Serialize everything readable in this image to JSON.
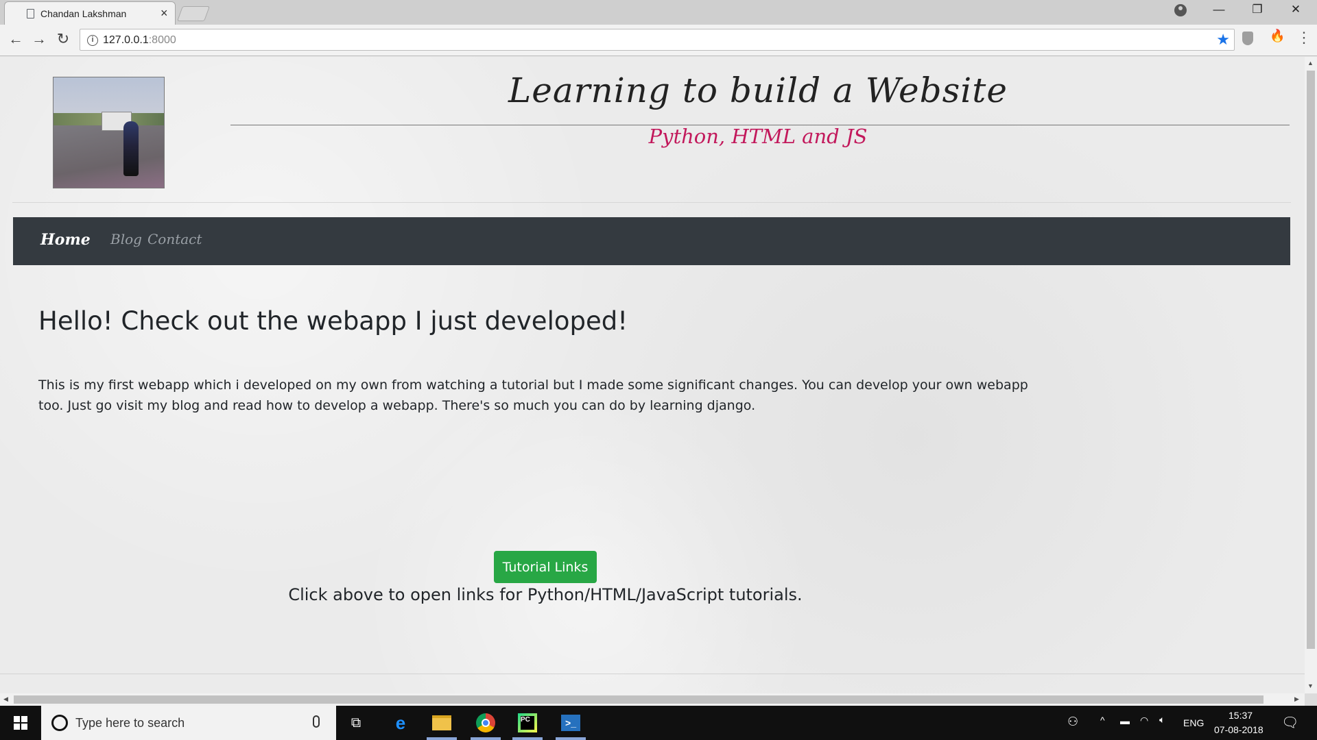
{
  "browser": {
    "tab_title": "Chandan Lakshman",
    "url_host": "127.0.0.1",
    "url_port": ":8000"
  },
  "site": {
    "title": "Learning to build a Website",
    "subtitle": "Python, HTML and JS",
    "nav": [
      "Home",
      "Blog",
      "Contact"
    ],
    "heading": "Hello! Check out the webapp I just developed!",
    "paragraph": "This is my first webapp which i developed on my own from watching a tutorial but I made some significant changes. You can develop your own webapp too. Just go visit my blog and read how to develop a webapp. There's so much you can do by learning django.",
    "button_label": "Tutorial Links",
    "button_caption": "Click above to open links for Python/HTML/JavaScript tutorials.",
    "colors": {
      "navbar": "#343a40",
      "button": "#28a745",
      "subtitle": "#c2185b"
    }
  },
  "taskbar": {
    "search_placeholder": "Type here to search",
    "language": "ENG",
    "time": "15:37",
    "date": "07-08-2018"
  }
}
